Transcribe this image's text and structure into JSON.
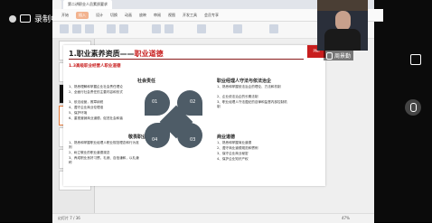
{
  "recording": {
    "label": "录制中"
  },
  "app": {
    "tabs": [
      "",
      "第二讲职业人员素质要求"
    ],
    "ribbon": [
      "开始",
      "插入",
      "设计",
      "切换",
      "动画",
      "放映",
      "审阅",
      "视图",
      "开发工具",
      "会员专享"
    ],
    "ribbon_highlight": "插入"
  },
  "slide": {
    "title_main": "1.职业素养资质——",
    "title_red": "职业道德",
    "subtitle": "1.3高级职业经营人职业道德",
    "logo_text": "PMI",
    "sections": [
      {
        "title": "社会责任",
        "items": [
          "1、熟悉理解和掌握企业社会责任理论",
          "2、全面行社会责任的主要内容和形式",
          "3、依法经营，照章纳税",
          "4、遵守企业商业伦理准",
          "5、保护环境",
          "6、重视营销商业道德，促进社会和谐"
        ]
      },
      {
        "title": "职业经理人守法与依法治企",
        "items": [
          "1、熟悉和掌握依法治企的理论、方法和机制",
          "2、企业依法治企的长期法制",
          "3、职业经理人守法遵纪的自律和监督内部控制机制"
        ]
      },
      {
        "title": "敬畏职业规范",
        "items": [
          "1、熟悉和掌握职业经理人职业规范理念和行为准则",
          "2、树立敬业的职业道德观念",
          "3、养成职业良好习惯，礼貌、自信谦和，以礼谦称"
        ]
      },
      {
        "title": "商业道德",
        "items": [
          "1、熟悉和掌握商业道德",
          "2、遵守商业道德规范和惯例",
          "3、保守企业商业秘密",
          "4、保护企业知识产权"
        ]
      }
    ],
    "diagram_numbers": [
      "01",
      "02",
      "03",
      "04"
    ]
  },
  "webcam": {
    "name": "周景勤"
  },
  "status": {
    "page": "幻灯片 7 / 36",
    "zoom": "47%"
  },
  "colors": {
    "accent": "#c81e1e",
    "diagram": "#4e5c67"
  }
}
